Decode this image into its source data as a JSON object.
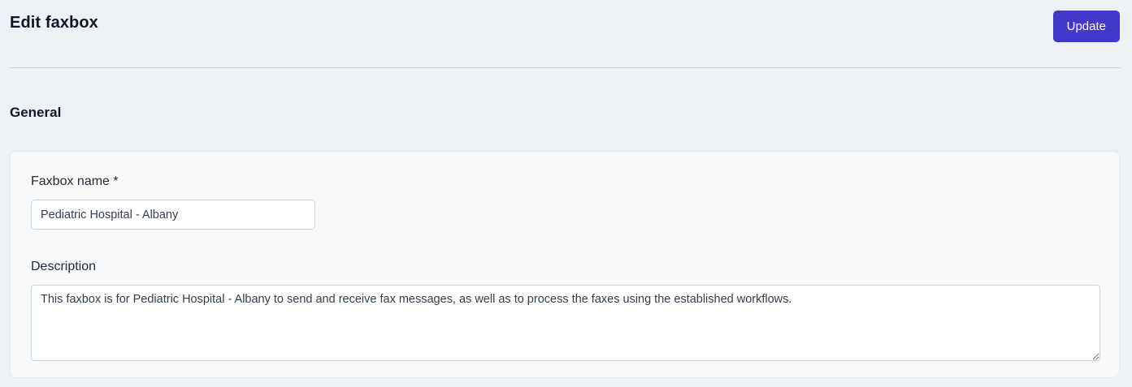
{
  "header": {
    "title": "Edit faxbox",
    "update_button_label": "Update"
  },
  "section": {
    "heading": "General"
  },
  "form": {
    "faxbox_name": {
      "label": "Faxbox name *",
      "value": "Pediatric Hospital - Albany"
    },
    "description": {
      "label": "Description",
      "value": "This faxbox is for Pediatric Hospital - Albany to send and receive fax messages, as well as to process the faxes using the established workflows."
    }
  },
  "colors": {
    "accent": "#4338ca",
    "page_background": "#edf1f6",
    "panel_background": "#f7f9fb",
    "divider": "#ccd4e0"
  }
}
